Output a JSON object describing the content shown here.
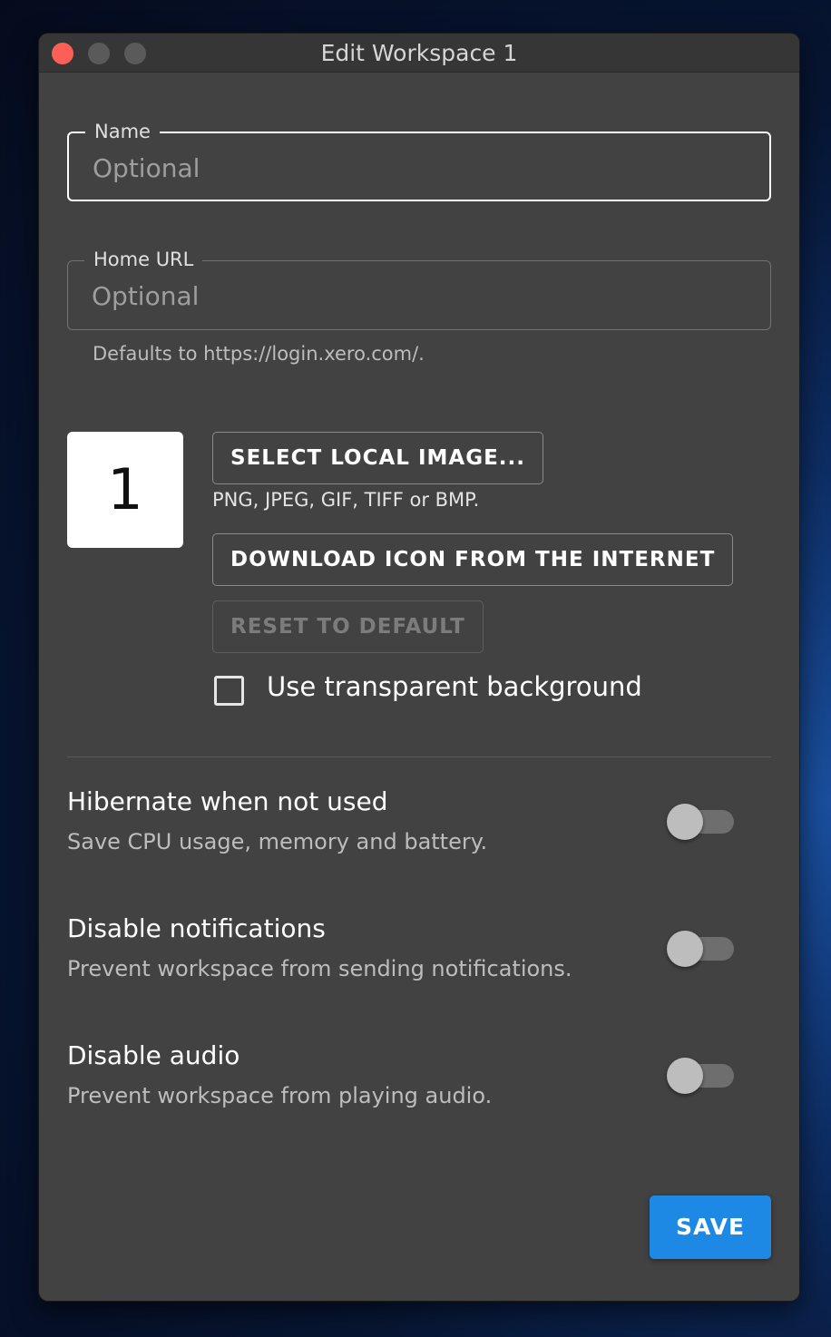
{
  "window": {
    "title": "Edit Workspace 1",
    "traffic_lights": [
      "close",
      "minimize",
      "maximize"
    ],
    "colors": {
      "close": "#fd5f57",
      "inactive": "#5a5a5a"
    }
  },
  "form": {
    "name": {
      "label": "Name",
      "value": "",
      "placeholder": "Optional"
    },
    "home_url": {
      "label": "Home URL",
      "value": "",
      "placeholder": "Optional",
      "helper": "Defaults to https://login.xero.com/."
    }
  },
  "icon": {
    "preview_text": "1",
    "select_local_label": "SELECT LOCAL IMAGE...",
    "formats_note": "PNG, JPEG, GIF, TIFF or BMP.",
    "download_label": "DOWNLOAD ICON FROM THE INTERNET",
    "reset_label": "RESET TO DEFAULT",
    "reset_disabled": true,
    "transparent_label": "Use transparent background",
    "transparent_checked": false
  },
  "settings": [
    {
      "title": "Hibernate when not used",
      "description": "Save CPU usage, memory and battery.",
      "enabled": false
    },
    {
      "title": "Disable notifications",
      "description": "Prevent workspace from sending notifications.",
      "enabled": false
    },
    {
      "title": "Disable audio",
      "description": "Prevent workspace from playing audio.",
      "enabled": false
    }
  ],
  "actions": {
    "save_label": "SAVE"
  },
  "colors": {
    "accent": "#1e88e5",
    "surface": "#424242"
  }
}
